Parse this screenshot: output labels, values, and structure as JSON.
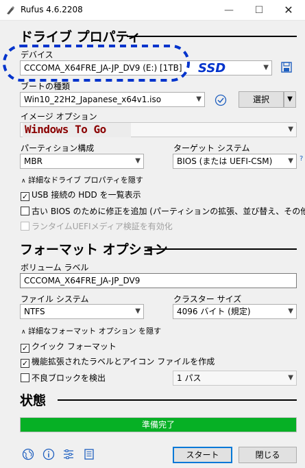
{
  "window": {
    "title": "Rufus 4.6.2208",
    "minimize": "—",
    "maximize": "☐",
    "close": "✕"
  },
  "drive_props": {
    "header": "ドライブ プロパティ",
    "device_label": "デバイス",
    "device_value": "CCCOMA_X64FRE_JA-JP_DV9 (E:) [1TB]",
    "annotation_ssd": "SSD",
    "boot_label": "ブートの種類",
    "boot_value": "Win10_22H2_Japanese_x64v1.iso",
    "select_button": "選択",
    "image_option_label": "イメージ オプション",
    "image_option_value": "Windows To Go",
    "partition_label": "パーティション構成",
    "partition_value": "MBR",
    "target_label": "ターゲット システム",
    "target_value": "BIOS (または UEFI-CSM)",
    "help_mark": "?",
    "advanced_toggle": "詳細なドライブ プロパティを隠す",
    "opt_usb_hdd": "USB 接続の HDD を一覧表示",
    "opt_old_bios": "古い BIOS のために修正を追加 (パーティションの拡張、並び替え、その他)",
    "opt_uefi_runtime": "ランタイムUEFIメディア検証を有効化"
  },
  "format": {
    "header": "フォーマット オプション",
    "volume_label": "ボリューム ラベル",
    "volume_value": "CCCOMA_X64FRE_JA-JP_DV9",
    "fs_label": "ファイル システム",
    "fs_value": "NTFS",
    "cluster_label": "クラスター サイズ",
    "cluster_value": "4096 バイト (規定)",
    "advanced_toggle": "詳細なフォーマット オプション を隠す",
    "opt_quick": "クイック フォーマット",
    "opt_extended": "機能拡張されたラベルとアイコン ファイルを作成",
    "opt_badblocks": "不良ブロックを検出",
    "passes_value": "1 パス"
  },
  "status": {
    "header": "状態",
    "progress_text": "準備完了",
    "progress_fraction": 1.0
  },
  "footer": {
    "start": "スタート",
    "close": "閉じる"
  },
  "colors": {
    "progress": "#06b025",
    "annotation": "#0033cc",
    "accent": "#0078d7"
  }
}
